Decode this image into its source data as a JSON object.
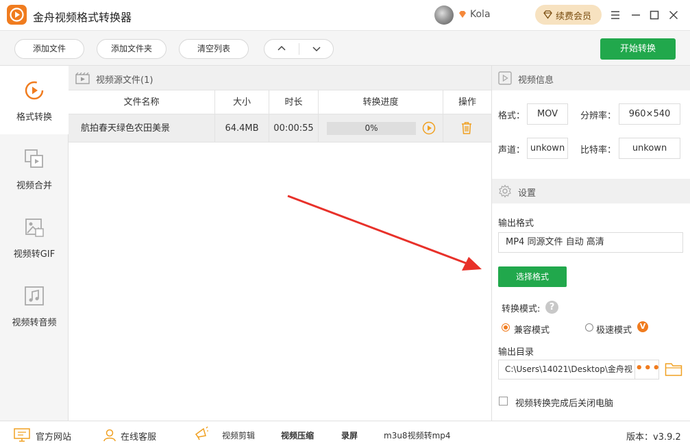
{
  "titlebar": {
    "app_title": "金舟视频格式转换器",
    "user_name": "Kola",
    "renew_label": "续费会员",
    "controls": [
      "menu-icon",
      "minimize-icon",
      "maximize-icon",
      "close-icon"
    ]
  },
  "toolbar": {
    "add_file": "添加文件",
    "add_folder": "添加文件夹",
    "clear_list": "清空列表",
    "start_convert": "开始转换"
  },
  "sidebar": {
    "items": [
      {
        "label": "格式转换",
        "icon": "format-convert-icon",
        "active": true
      },
      {
        "label": "视频合并",
        "icon": "video-merge-icon",
        "active": false
      },
      {
        "label": "视频转GIF",
        "icon": "video-gif-icon",
        "active": false
      },
      {
        "label": "视频转音频",
        "icon": "video-audio-icon",
        "active": false
      }
    ]
  },
  "filepanel": {
    "header": "视频源文件(1)",
    "columns": [
      "文件名称",
      "大小",
      "时长",
      "转换进度",
      "操作"
    ],
    "rows": [
      {
        "name": "航拍春天绿色农田美景",
        "size": "64.4MB",
        "duration": "00:00:55",
        "progress_label": "0%",
        "progress": 0
      }
    ]
  },
  "video_info": {
    "header": "视频信息",
    "format_label": "格式：",
    "format_value": "MOV",
    "resolution_label": "分辨率：",
    "resolution_value": "960×540",
    "channel_label": "声道：",
    "channel_value": "unkown",
    "bitrate_label": "比特率：",
    "bitrate_value": "unkown"
  },
  "settings": {
    "header": "设置",
    "output_format_label": "输出格式",
    "output_format_value": "MP4 同源文件 自动 高清",
    "choose_format": "选择格式",
    "mode_label": "转换模式:",
    "mode_compat": "兼容模式",
    "mode_fast": "极速模式",
    "fast_badge": "V",
    "output_dir_label": "输出目录",
    "output_dir_value": "C:\\Users\\14021\\Desktop\\金舟视",
    "dots": "•••",
    "shutdown_label": "视频转换完成后关闭电脑"
  },
  "bottombar": {
    "website": "官方网站",
    "support": "在线客服",
    "video_edit": "视频剪辑",
    "video_compress": "视频压缩",
    "record": "录屏",
    "m3u8": "m3u8视频转mp4",
    "version": "版本：v3.9.2"
  },
  "colors": {
    "accent_orange": "#f07c1f",
    "accent_green": "#21a84c",
    "annotation_red": "#e8312a"
  }
}
